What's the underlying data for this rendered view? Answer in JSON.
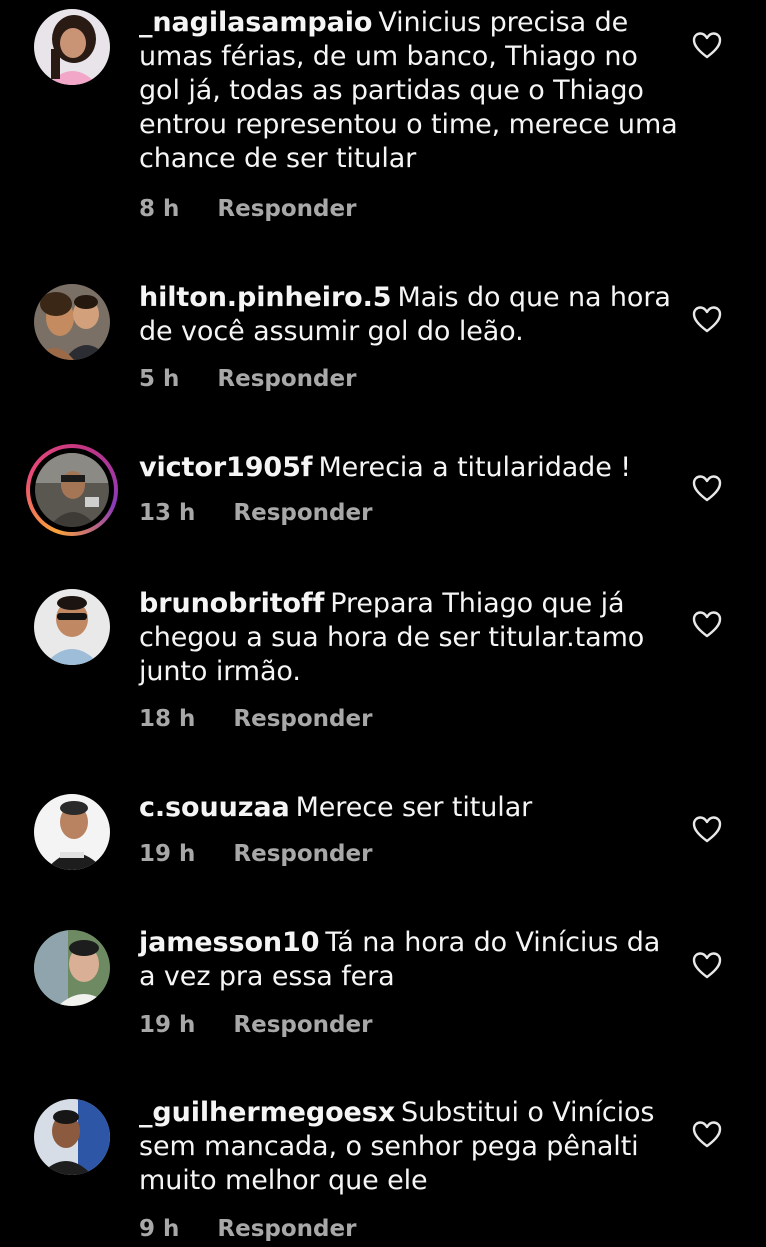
{
  "reply_label": "Responder",
  "comments": [
    {
      "username": "_nagilasampaio",
      "text": "Vinicius precisa de umas férias, de um banco, Thiago no gol já, todas as partidas que o Thiago entrou representou o time, merece uma chance de ser titular",
      "time": "8 h"
    },
    {
      "username": "hilton.pinheiro.5",
      "text": "Mais do que na hora de você assumir gol do leão.",
      "time": "5 h"
    },
    {
      "username": "victor1905f",
      "text": "Merecia a titularidade !",
      "time": "13 h"
    },
    {
      "username": "brunobritoff",
      "text": "Prepara Thiago que já chegou a sua hora de ser titular.tamo junto irmão.",
      "time": "18 h"
    },
    {
      "username": "c.souuzaa",
      "text": "Merece ser titular",
      "time": "19 h"
    },
    {
      "username": "jamesson10",
      "text": "Tá na hora do Vinícius da a vez pra essa fera",
      "time": "19 h"
    },
    {
      "username": "_guilhermegoesx",
      "text": "Substitui o Vinícios sem mancada, o senhor pega pênalti muito melhor que ele",
      "time": "9 h"
    }
  ]
}
